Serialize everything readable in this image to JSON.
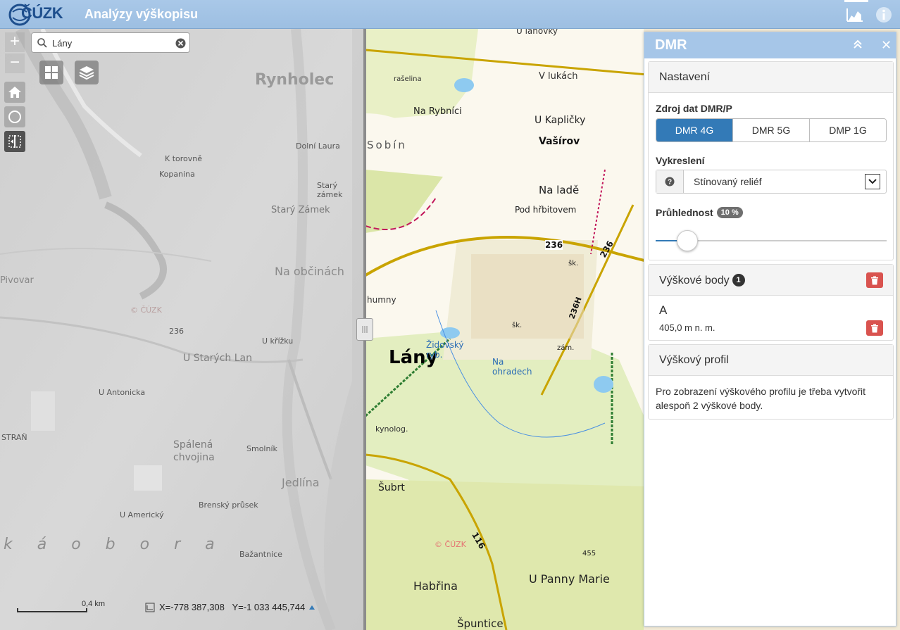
{
  "header": {
    "logo_text": "ČÚZK",
    "app_title": "Analýzy výškopisu",
    "profile_icon": "elevation-profile-icon",
    "info_icon": "info-icon"
  },
  "map_controls": {
    "zoom_in": "+",
    "zoom_out": "−",
    "search": {
      "value": "Lány",
      "placeholder": ""
    },
    "scale_label": "0,4 km",
    "coords": "X=-778 387,308   Y=-1 033 445,744"
  },
  "map_left_labels": {
    "rynholec": "Rynholec",
    "k_torovne": "K torovně",
    "kopanina": "Kopanina",
    "stary_zamek": "Starý Zámek",
    "stary_zamek2": "Starý zámek",
    "na_obcinach": "Na občinách",
    "dolni_laura": "Dolní Laura",
    "pivovar": "Pivovar",
    "road_236": "236",
    "u_starych_lan": "U Starých Lan",
    "u_kriz": "U křížku",
    "u_antonicka": "U Antonicka",
    "stran": "STRAŇ",
    "spalena_chvojina": "Spálená chvojina",
    "jedlina": "Jedlína",
    "u_americky": "U Americký",
    "brensky_prusek": "Brenský průsek",
    "bazantnice": "Bažantnice",
    "k_a_o_b_o_r_a": "k á o b o r a",
    "smolnik": "Smolník",
    "cuzk": "© ČÚZK"
  },
  "map_right_labels": {
    "rasselina": "rašelina",
    "v_lukach": "V lukách",
    "na_rybnici": "Na Rybníci",
    "u_kaplicky": "U Kapličky",
    "vasirov": "Vašírov",
    "na_lade": "Na ladě",
    "pod_hrbitovem": "Pod hřbitovem",
    "road_236a": "236",
    "road_236b": "236",
    "road_236h": "236H",
    "humny": "humny",
    "lany": "Lány",
    "zidovsky_ryb": "Židovský ryb.",
    "na_ohradech": "Na ohradech",
    "kynolog": "kynolog.",
    "subrt": "Šubrt",
    "road_116": "116",
    "cuzk": "© ČÚZK",
    "h455": "455",
    "u_panny_marie": "U Panny Marie",
    "habrina": "Habřina",
    "spuntice": "Špuntice",
    "zam": "zám.",
    "sobin": "Sobín",
    "sk1": "šk.",
    "sk2": "šk.",
    "u_lanovky": "U lanovky"
  },
  "panel": {
    "title": "DMR",
    "settings": {
      "heading": "Nastavení",
      "source_label": "Zdroj dat DMR/P",
      "sources": [
        "DMR 4G",
        "DMR 5G",
        "DMP 1G"
      ],
      "active_source": "DMR 4G",
      "render_label": "Vykreslení",
      "render_value": "Stínovaný reliéf",
      "opacity_label": "Průhlednost",
      "opacity_value": "10 %",
      "opacity_fraction": 0.1
    },
    "points": {
      "heading": "Výškové body",
      "count": "1",
      "items": [
        {
          "name": "A",
          "elevation": "405,0 m n. m."
        }
      ]
    },
    "profile": {
      "heading": "Výškový profil",
      "message": "Pro zobrazení výškového profilu je třeba vytvořit alespoň 2 výškové body."
    }
  },
  "colors": {
    "header": "#a9c8e8",
    "accent": "#337ab7",
    "danger": "#d9534f"
  }
}
